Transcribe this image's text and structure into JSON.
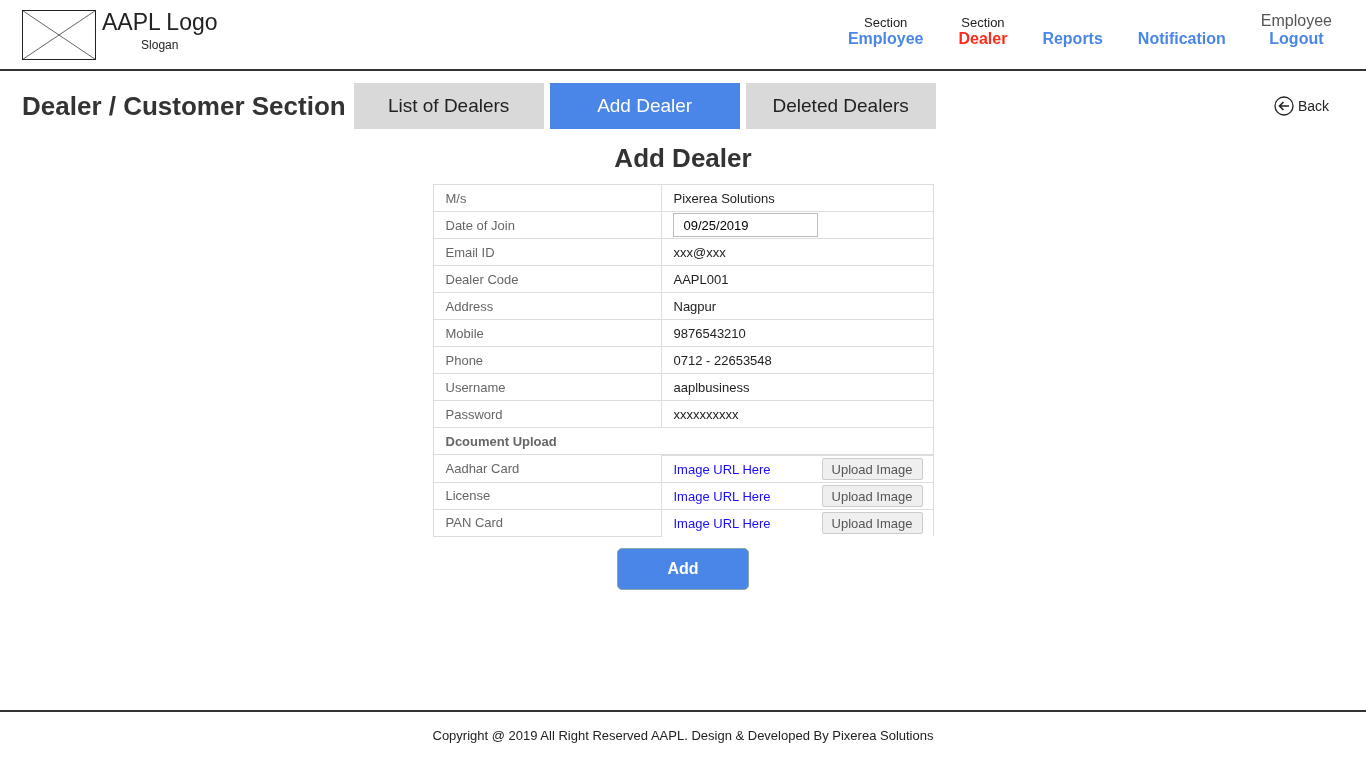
{
  "header": {
    "logo": "AAPL Logo",
    "slogan": "Slogan",
    "nav": [
      {
        "caption": "Section",
        "label": "Employee",
        "selected": false
      },
      {
        "caption": "Section",
        "label": "Dealer",
        "selected": true
      },
      {
        "label": "Reports",
        "selected": false
      },
      {
        "label": "Notification",
        "selected": false
      },
      {
        "caption": "Employee",
        "label": "Logout",
        "selected": false
      }
    ]
  },
  "section_title": "Dealer / Customer Section",
  "tabs": [
    {
      "label": "List of Dealers",
      "selected": false
    },
    {
      "label": "Add Dealer",
      "selected": true
    },
    {
      "label": "Deleted Dealers",
      "selected": false
    }
  ],
  "back": "Back",
  "form": {
    "title": "Add Dealer",
    "rows": [
      {
        "kind": "text",
        "label": "M/s",
        "value": "Pixerea Solutions"
      },
      {
        "kind": "date",
        "label": "Date of Join",
        "value": "09/25/2019"
      },
      {
        "kind": "text",
        "label": "Email ID",
        "value": "xxx@xxx"
      },
      {
        "kind": "text",
        "label": "Dealer Code",
        "value": "AAPL001"
      },
      {
        "kind": "text",
        "label": "Address",
        "value": "Nagpur"
      },
      {
        "kind": "text",
        "label": "Mobile",
        "value": "9876543210"
      },
      {
        "kind": "text",
        "label": "Phone",
        "value": "0712 - 22653548"
      },
      {
        "kind": "text",
        "label": "Username",
        "value": "aaplbusiness"
      },
      {
        "kind": "text",
        "label": "Password",
        "value": "xxxxxxxxxx"
      },
      {
        "kind": "heading",
        "label": "Dcoument Upload"
      },
      {
        "kind": "upload",
        "label": "Aadhar Card",
        "value": "Image URL Here",
        "button": "Upload Image"
      },
      {
        "kind": "upload",
        "label": "License",
        "value": "Image URL Here",
        "button": "Upload Image"
      },
      {
        "kind": "upload",
        "label": "PAN Card",
        "value": "Image URL Here",
        "button": "Upload Image"
      }
    ],
    "submit": "Add"
  },
  "footer": "Copyright @ 2019 All Right Reserved AAPL. Design & Developed By Pixerea Solutions"
}
